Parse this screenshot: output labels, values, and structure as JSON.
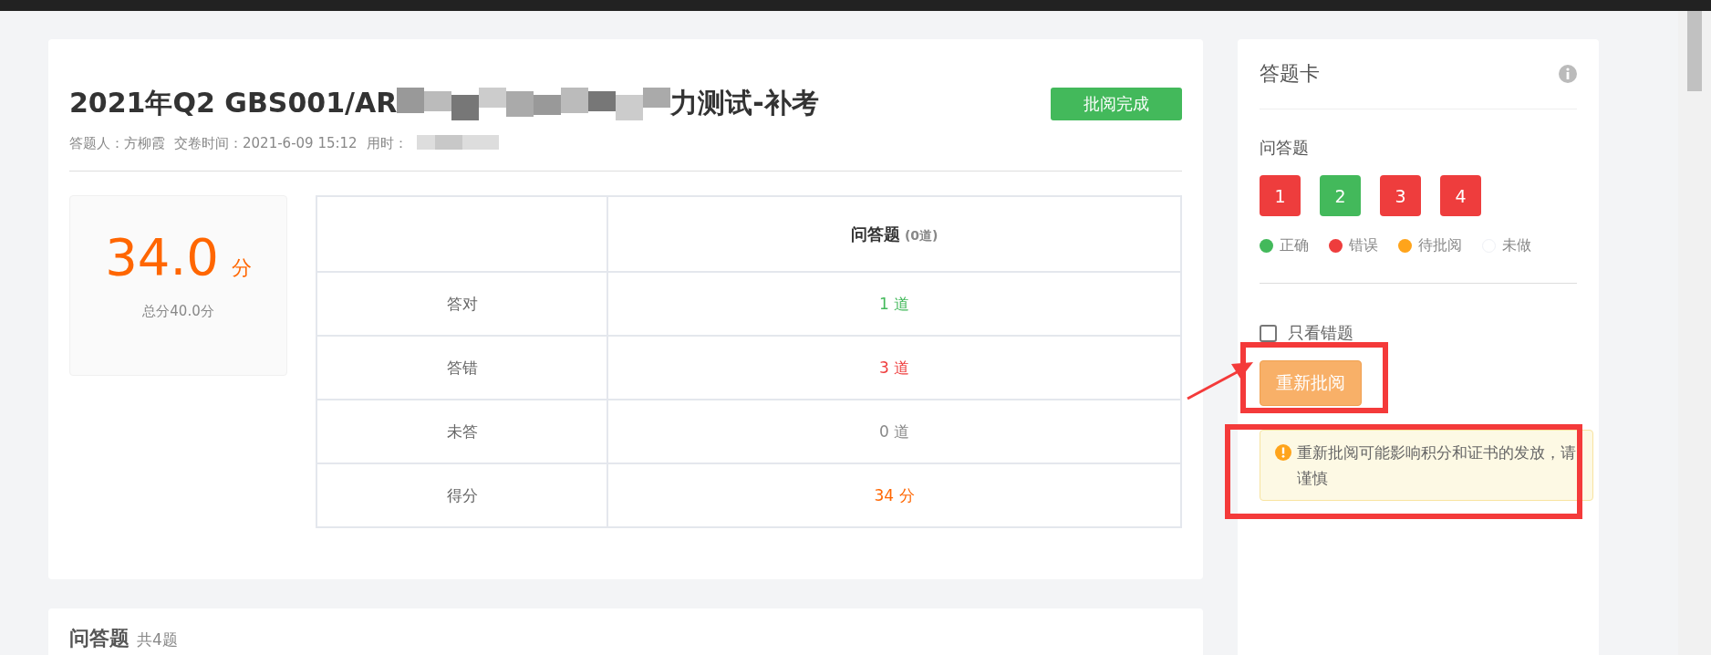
{
  "exam": {
    "title_start": "2021年Q2 GBS001/AR",
    "title_end": "力测试-补考",
    "status_badge": "批阅完成",
    "answerer": "答题人：方柳霞",
    "submit_time": "交卷时间：2021-6-09 15:12",
    "duration_label": "用时："
  },
  "score": {
    "value": "34.0",
    "unit": "分",
    "total": "总分40.0分"
  },
  "table": {
    "header": {
      "title": "问答题",
      "count": "(0道)"
    },
    "rows": [
      {
        "label": "答对",
        "value": "1 道",
        "color": "#43b95b"
      },
      {
        "label": "答错",
        "value": "3 道",
        "color": "#ee3d3d"
      },
      {
        "label": "未答",
        "value": "0 道",
        "color": "#888888"
      },
      {
        "label": "得分",
        "value": "34 分",
        "color": "#ff6600"
      }
    ]
  },
  "answer_card": {
    "title": "答题卡",
    "section": "问答题",
    "questions": [
      {
        "number": "1",
        "color": "#ee3d3d"
      },
      {
        "number": "2",
        "color": "#43b95b"
      },
      {
        "number": "3",
        "color": "#ee3d3d"
      },
      {
        "number": "4",
        "color": "#ee3d3d"
      }
    ],
    "legend": [
      {
        "label": "正确",
        "color": "#43b95b"
      },
      {
        "label": "错误",
        "color": "#ee3d3d"
      },
      {
        "label": "待批阅",
        "color": "#ffa41b"
      },
      {
        "label": "未做",
        "color": "#ffffff"
      }
    ],
    "only_wrong": {
      "label": "只看错题",
      "checked": false
    },
    "regrade_button": "重新批阅",
    "warning": "重新批阅可能影响积分和证书的发放，请谨慎"
  },
  "questions_section": {
    "title": "问答题",
    "count": "共4题"
  }
}
